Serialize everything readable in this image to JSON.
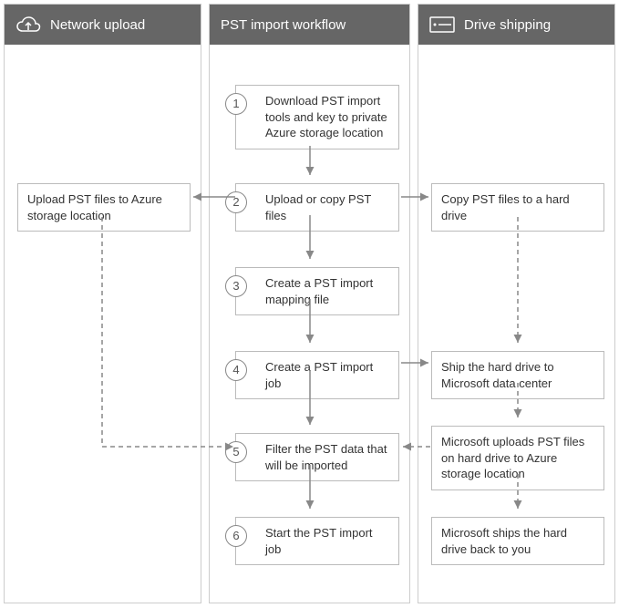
{
  "columns": {
    "left": {
      "title": "Network upload"
    },
    "mid": {
      "title": "PST import workflow"
    },
    "right": {
      "title": "Drive shipping"
    }
  },
  "workflow": {
    "step1": {
      "num": "1",
      "text": "Download PST import tools and key to private Azure storage location"
    },
    "step2": {
      "num": "2",
      "text": "Upload or copy PST files"
    },
    "step3": {
      "num": "3",
      "text": "Create a PST import mapping file"
    },
    "step4": {
      "num": "4",
      "text": "Create a PST import job"
    },
    "step5": {
      "num": "5",
      "text": "Filter the PST data that will be imported"
    },
    "step6": {
      "num": "6",
      "text": "Start the PST import job"
    }
  },
  "left_box": {
    "text": "Upload PST files to Azure storage location"
  },
  "right_boxes": {
    "r1": {
      "text": "Copy PST files to a hard drive"
    },
    "r2": {
      "text": "Ship the hard drive to Microsoft data center"
    },
    "r3": {
      "text": "Microsoft uploads PST files on hard drive to Azure storage location"
    },
    "r4": {
      "text": "Microsoft ships the hard drive back to you"
    }
  },
  "chart_data": {
    "type": "table",
    "title": "PST import workflow — three swimlanes",
    "lanes": [
      "Network upload",
      "PST import workflow",
      "Drive shipping"
    ],
    "nodes": [
      {
        "id": "s1",
        "lane": "PST import workflow",
        "label": "1. Download PST import tools and key to private Azure storage location"
      },
      {
        "id": "s2",
        "lane": "PST import workflow",
        "label": "2. Upload or copy PST files"
      },
      {
        "id": "s3",
        "lane": "PST import workflow",
        "label": "3. Create a PST import mapping file"
      },
      {
        "id": "s4",
        "lane": "PST import workflow",
        "label": "4. Create a PST import job"
      },
      {
        "id": "s5",
        "lane": "PST import workflow",
        "label": "5. Filter the PST data that will be imported"
      },
      {
        "id": "s6",
        "lane": "PST import workflow",
        "label": "6. Start the PST import job"
      },
      {
        "id": "L1",
        "lane": "Network upload",
        "label": "Upload PST files to Azure storage location"
      },
      {
        "id": "R1",
        "lane": "Drive shipping",
        "label": "Copy PST files to a hard drive"
      },
      {
        "id": "R2",
        "lane": "Drive shipping",
        "label": "Ship the hard drive to Microsoft data center"
      },
      {
        "id": "R3",
        "lane": "Drive shipping",
        "label": "Microsoft uploads PST files on hard drive to Azure storage location"
      },
      {
        "id": "R4",
        "lane": "Drive shipping",
        "label": "Microsoft ships the hard drive back to you"
      }
    ],
    "edges": [
      {
        "from": "s1",
        "to": "s2",
        "style": "solid"
      },
      {
        "from": "s2",
        "to": "s3",
        "style": "solid"
      },
      {
        "from": "s3",
        "to": "s4",
        "style": "solid"
      },
      {
        "from": "s4",
        "to": "s5",
        "style": "solid"
      },
      {
        "from": "s5",
        "to": "s6",
        "style": "solid"
      },
      {
        "from": "s2",
        "to": "L1",
        "style": "solid"
      },
      {
        "from": "s2",
        "to": "R1",
        "style": "solid"
      },
      {
        "from": "s4",
        "to": "R2",
        "style": "solid"
      },
      {
        "from": "L1",
        "to": "s5",
        "style": "dashed"
      },
      {
        "from": "R1",
        "to": "R2",
        "style": "dashed"
      },
      {
        "from": "R2",
        "to": "R3",
        "style": "dashed"
      },
      {
        "from": "R3",
        "to": "s5",
        "style": "dashed"
      },
      {
        "from": "R3",
        "to": "R4",
        "style": "dashed"
      }
    ]
  }
}
